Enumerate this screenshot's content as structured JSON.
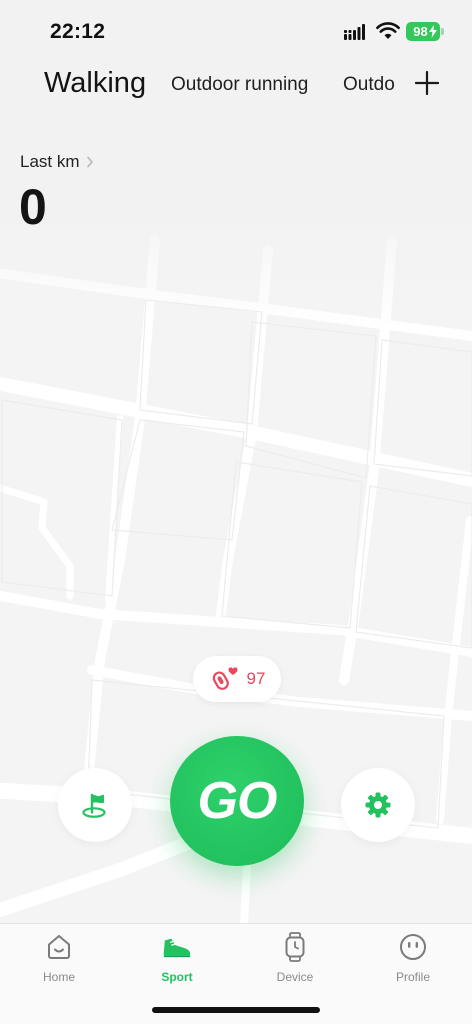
{
  "status": {
    "time": "22:12",
    "battery": "98"
  },
  "tabs": {
    "walking": "Walking",
    "outdoor_running": "Outdoor running",
    "outdo": "Outdo"
  },
  "stats": {
    "label": "Last km",
    "value": "0"
  },
  "heart_rate": {
    "value": "97"
  },
  "actions": {
    "go": "GO"
  },
  "nav": {
    "items": [
      {
        "label": "Home"
      },
      {
        "label": "Sport"
      },
      {
        "label": "Device"
      },
      {
        "label": "Profile"
      }
    ]
  },
  "colors": {
    "accent": "#23c160",
    "heart": "#e9485d",
    "battery": "#34c759"
  }
}
